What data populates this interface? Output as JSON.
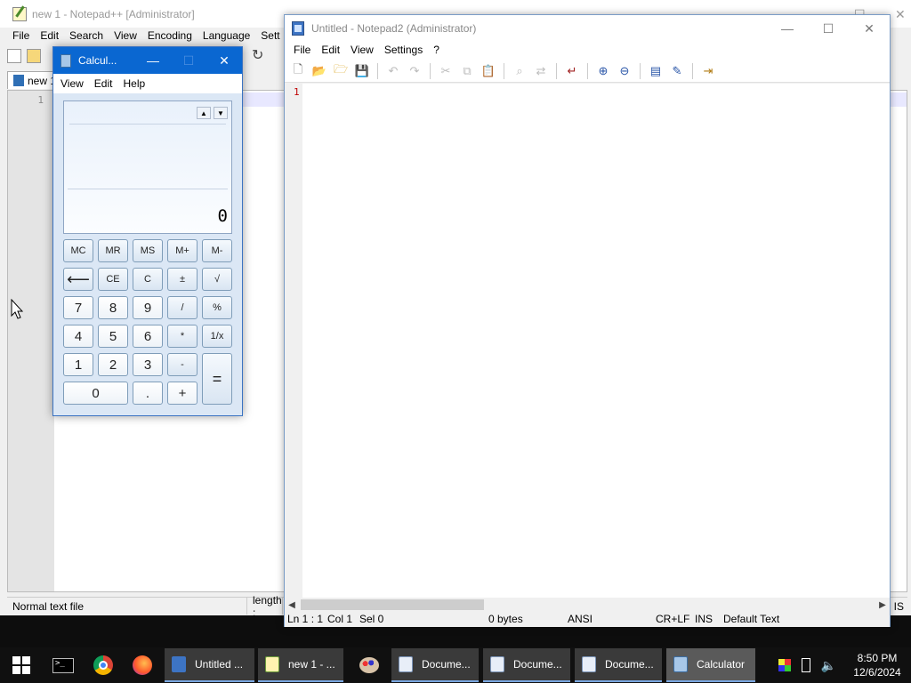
{
  "npp": {
    "title": "new 1 - Notepad++ [Administrator]",
    "menu": [
      "File",
      "Edit",
      "Search",
      "View",
      "Encoding",
      "Language",
      "Sett"
    ],
    "tab_label": "new 1",
    "line_number": "1",
    "status_left": "Normal text file",
    "status_length": "length :",
    "status_right": "IS"
  },
  "np2": {
    "title": "Untitled - Notepad2 (Administrator)",
    "menu": [
      "File",
      "Edit",
      "View",
      "Settings",
      "?"
    ],
    "line_number": "1",
    "status": {
      "pos": "Ln 1 : 1",
      "col": "Col 1",
      "sel": "Sel 0",
      "size": "0 bytes",
      "encoding": "ANSI",
      "eol": "CR+LF",
      "mode": "INS",
      "scheme": "Default Text"
    }
  },
  "calc": {
    "title": "Calcul...",
    "menu": [
      "View",
      "Edit",
      "Help"
    ],
    "display_value": "0",
    "keys": {
      "mc": "MC",
      "mr": "MR",
      "ms": "MS",
      "mplus": "M+",
      "mminus": "M-",
      "back": "⟵",
      "ce": "CE",
      "c": "C",
      "sign": "±",
      "sqrt": "√",
      "d7": "7",
      "d8": "8",
      "d9": "9",
      "div": "/",
      "pct": "%",
      "d4": "4",
      "d5": "5",
      "d6": "6",
      "mul": "*",
      "recip": "1/x",
      "d1": "1",
      "d2": "2",
      "d3": "3",
      "sub": "-",
      "eq": "=",
      "d0": "0",
      "dot": ".",
      "add": "+"
    }
  },
  "taskbar": {
    "tasks": [
      {
        "label": "Untitled ...",
        "icon": "notepad2-icon"
      },
      {
        "label": "new 1 - ...",
        "icon": "notepadpp-icon"
      },
      {
        "label": "Docume...",
        "icon": "document-icon"
      },
      {
        "label": "Docume...",
        "icon": "document-icon"
      },
      {
        "label": "Docume...",
        "icon": "document-icon"
      },
      {
        "label": "Calculator",
        "icon": "calculator-icon"
      }
    ],
    "time": "8:50 PM",
    "date": "12/6/2024"
  },
  "colors": {
    "calc_title": "#0a67d1",
    "taskbar": "#101010",
    "np2_line_number": "#c00000"
  }
}
